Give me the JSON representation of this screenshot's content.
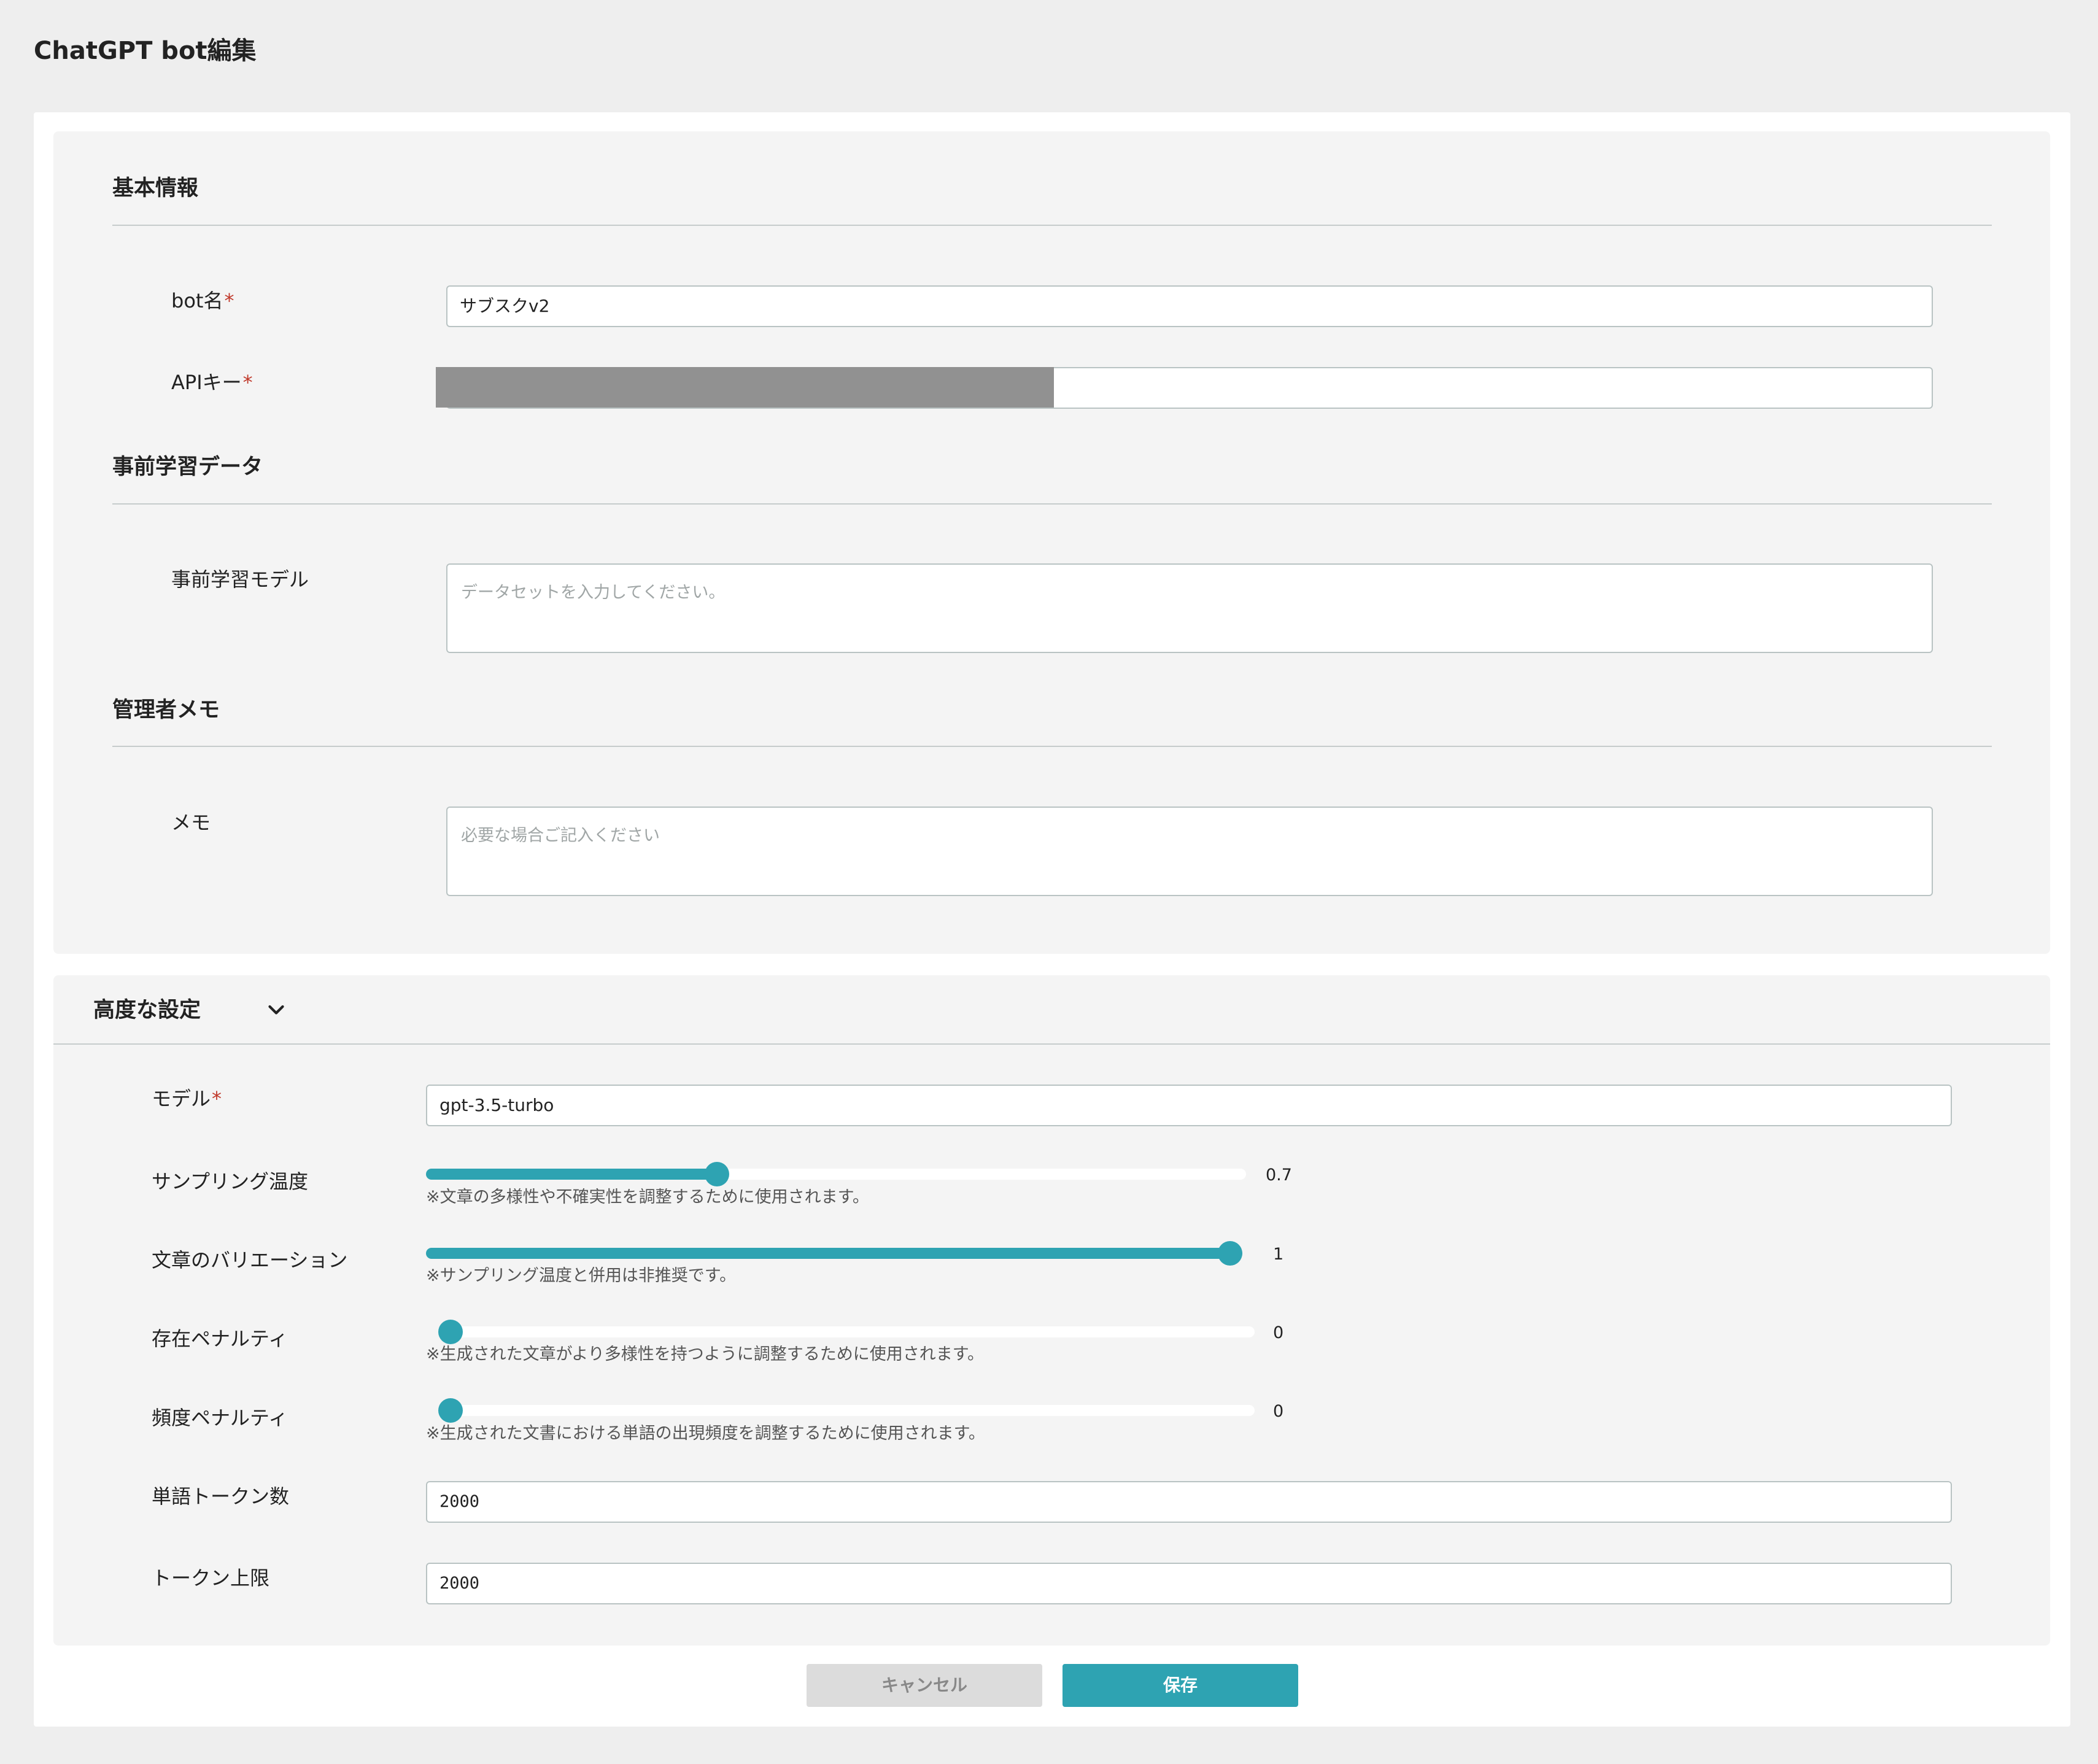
{
  "page": {
    "title": "ChatGPT bot編集"
  },
  "basic_info": {
    "title": "基本情報",
    "bot_name": {
      "label": "bot名",
      "required_mark": "*",
      "value": "サブスクv2"
    },
    "api_key": {
      "label": "APIキー",
      "required_mark": "*",
      "value": ""
    }
  },
  "pretraining": {
    "title": "事前学習データ",
    "model": {
      "label": "事前学習モデル",
      "placeholder": "データセットを入力してください。"
    }
  },
  "admin_memo": {
    "title": "管理者メモ",
    "memo": {
      "label": "メモ",
      "placeholder": "必要な場合ご記入ください"
    }
  },
  "advanced": {
    "title": "高度な設定",
    "toggle_icon": "chevron-down-icon",
    "model": {
      "label": "モデル",
      "required_mark": "*",
      "value": "gpt-3.5-turbo"
    },
    "temperature": {
      "label": "サンプリング温度",
      "value": "0.7",
      "fill_fraction": 0.355,
      "help": "※文章の多様性や不確実性を調整するために使用されます。"
    },
    "top_p": {
      "label": "文章のバリエーション",
      "value": "1",
      "fill_fraction": 1.0,
      "help": "※サンプリング温度と併用は非推奨です。"
    },
    "presence_penalty": {
      "label": "存在ペナルティ",
      "value": "0",
      "fill_fraction": 0,
      "help": "※生成された文章がより多様性を持つように調整するために使用されます。"
    },
    "frequency_penalty": {
      "label": "頻度ペナルティ",
      "value": "0",
      "fill_fraction": 0,
      "help": "※生成された文書における単語の出現頻度を調整するために使用されます。"
    },
    "word_tokens": {
      "label": "単語トークン数",
      "value": "2000"
    },
    "token_limit": {
      "label": "トークン上限",
      "value": "2000"
    }
  },
  "actions": {
    "cancel_label": "キャンセル",
    "save_label": "保存"
  },
  "colors": {
    "accent": "#2ea3b2",
    "required": "#c0392b",
    "background": "#eeeeee"
  }
}
